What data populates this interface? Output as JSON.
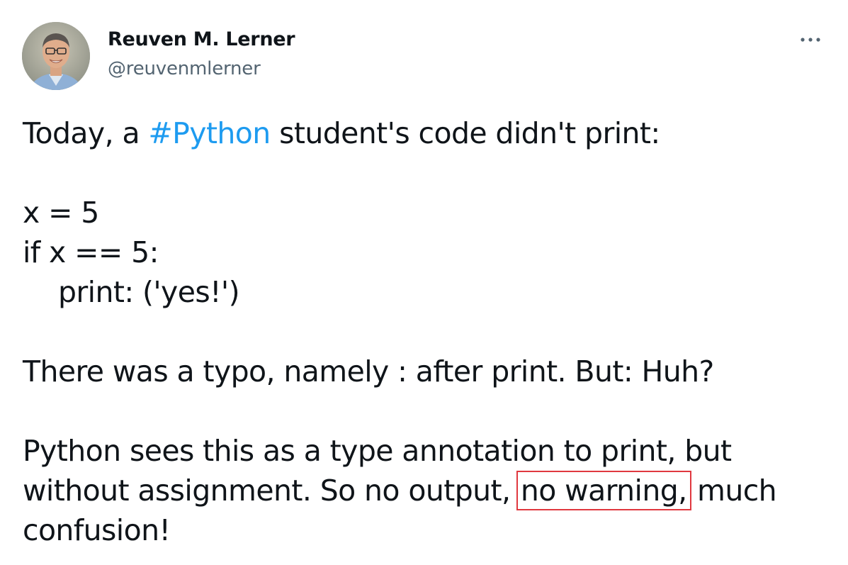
{
  "author": {
    "name": "Reuven M. Lerner",
    "handle": "@reuvenmlerner"
  },
  "tweet": {
    "line1_before": "Today, a ",
    "hashtag": "#Python",
    "line1_after": " student's code didn't print:",
    "code_line1": "x = 5",
    "code_line2": "if x == 5:",
    "code_line3": "print: ('yes!')",
    "line_typo": "There was a typo, namely : after print. But: Huh?",
    "line_explain1": "Python sees this as a type annotation to print, but",
    "line_explain2_before": "without assignment. So no output, ",
    "line_explain2_highlight": "no warning,",
    "line_explain2_after": " much",
    "line_explain3": "confusion!"
  },
  "icons": {
    "more": "more-horizontal-icon"
  },
  "colors": {
    "hashtag": "#1d9bf0",
    "highlight_border": "#e0383f",
    "handle": "#536471",
    "text": "#0f1419"
  }
}
